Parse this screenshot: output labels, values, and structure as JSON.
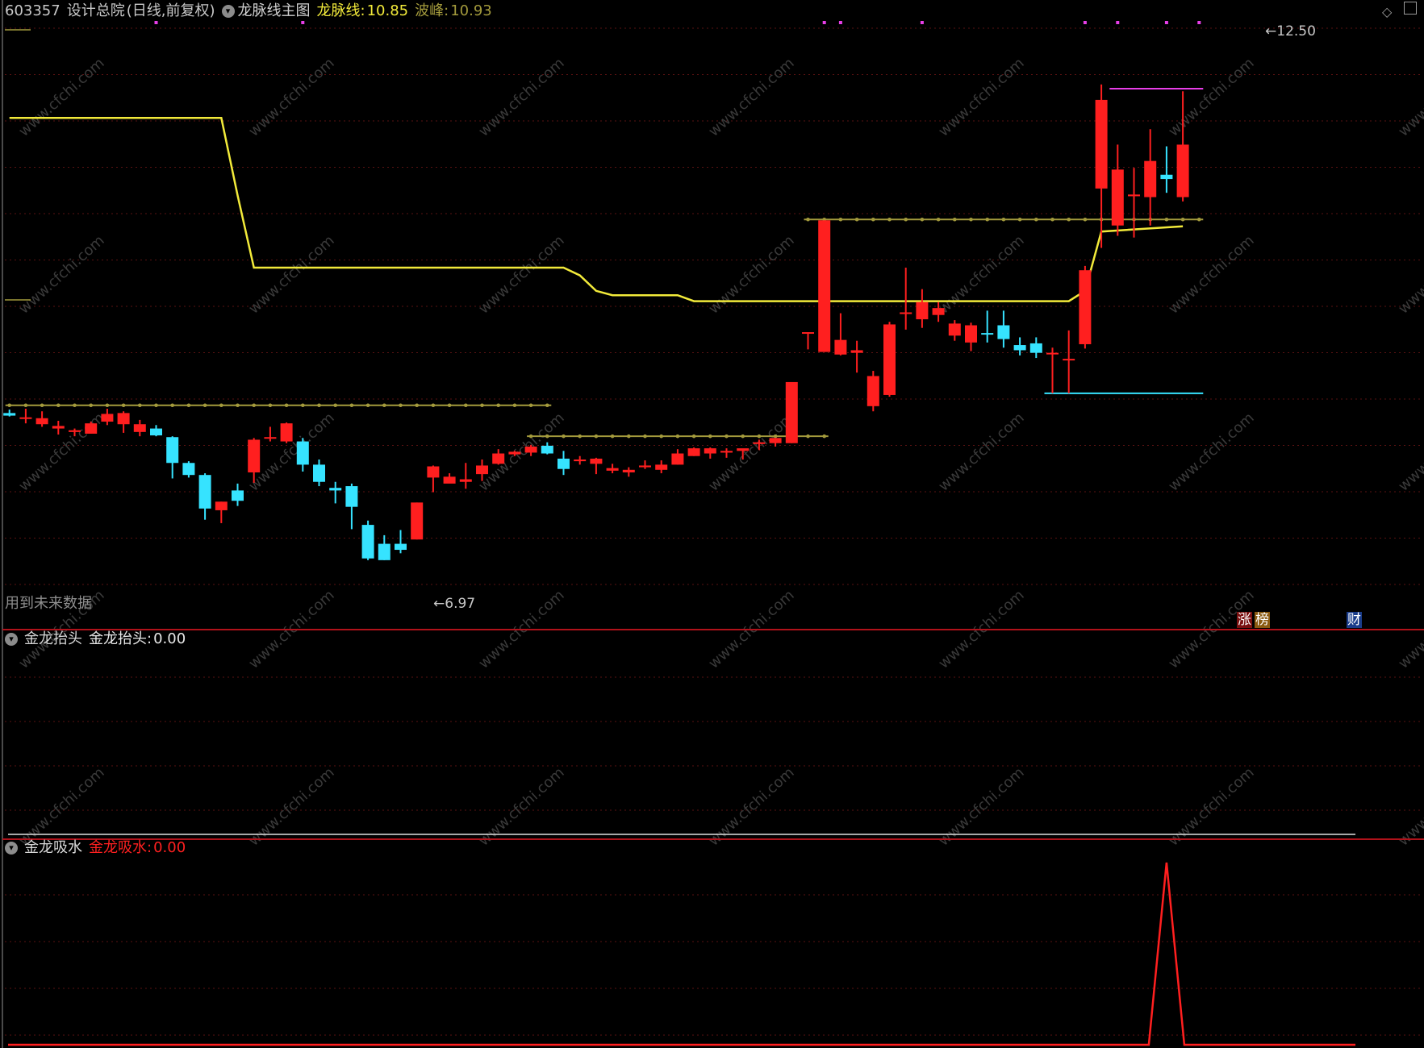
{
  "header": {
    "code": "603357",
    "name": "设计总院",
    "period": "(日线,前复权)",
    "indicator_name": "龙脉线主图",
    "line_label": "龙脉线:",
    "line_value": "10.85",
    "peak_label": "波峰:",
    "peak_value": "10.93"
  },
  "panel2": {
    "title": "金龙抬头",
    "label": "金龙抬头:",
    "value": "0.00"
  },
  "panel3": {
    "title": "金龙吸水",
    "label": "金龙吸水:",
    "value": "0.00"
  },
  "annotations": {
    "high_marker": "12.50",
    "low_marker": "6.97",
    "future_data_note": "用到未来数据"
  },
  "badges": {
    "zhang": "涨",
    "bang": "榜",
    "cai": "财"
  },
  "watermark": "www.cfchi.com",
  "colors": {
    "background": "#000000",
    "up": "#ff1f1f",
    "down": "#36e3ff",
    "line_yellow": "#f2ea3a",
    "line_olive": "#a39a3c",
    "magenta": "#e83ee8",
    "panel_divider": "#b0121a",
    "grid": "#5a1212"
  },
  "chart_data": {
    "type": "candlestick",
    "price_range": [
      6.5,
      13.2
    ],
    "candles": [
      {
        "o": 8.68,
        "h": 8.72,
        "l": 8.64,
        "c": 8.65
      },
      {
        "o": 8.62,
        "h": 8.73,
        "l": 8.56,
        "c": 8.63
      },
      {
        "o": 8.55,
        "h": 8.7,
        "l": 8.52,
        "c": 8.62
      },
      {
        "o": 8.5,
        "h": 8.59,
        "l": 8.43,
        "c": 8.53
      },
      {
        "o": 8.46,
        "h": 8.5,
        "l": 8.41,
        "c": 8.48
      },
      {
        "o": 8.44,
        "h": 8.58,
        "l": 8.44,
        "c": 8.56
      },
      {
        "o": 8.58,
        "h": 8.73,
        "l": 8.54,
        "c": 8.67
      },
      {
        "o": 8.55,
        "h": 8.7,
        "l": 8.45,
        "c": 8.68
      },
      {
        "o": 8.46,
        "h": 8.6,
        "l": 8.41,
        "c": 8.55
      },
      {
        "o": 8.5,
        "h": 8.54,
        "l": 8.41,
        "c": 8.42
      },
      {
        "o": 8.4,
        "h": 8.41,
        "l": 7.92,
        "c": 8.1
      },
      {
        "o": 8.1,
        "h": 8.12,
        "l": 7.93,
        "c": 7.96
      },
      {
        "o": 7.96,
        "h": 7.98,
        "l": 7.44,
        "c": 7.57
      },
      {
        "o": 7.55,
        "h": 7.65,
        "l": 7.4,
        "c": 7.65
      },
      {
        "o": 7.78,
        "h": 7.86,
        "l": 7.6,
        "c": 7.66
      },
      {
        "o": 7.99,
        "h": 8.39,
        "l": 7.87,
        "c": 8.37
      },
      {
        "o": 8.4,
        "h": 8.52,
        "l": 8.35,
        "c": 8.4
      },
      {
        "o": 8.35,
        "h": 8.57,
        "l": 8.33,
        "c": 8.56
      },
      {
        "o": 8.35,
        "h": 8.39,
        "l": 8.0,
        "c": 8.08
      },
      {
        "o": 8.08,
        "h": 8.14,
        "l": 7.83,
        "c": 7.88
      },
      {
        "o": 7.81,
        "h": 7.88,
        "l": 7.63,
        "c": 7.78
      },
      {
        "o": 7.83,
        "h": 7.86,
        "l": 7.33,
        "c": 7.59
      },
      {
        "o": 7.38,
        "h": 7.43,
        "l": 6.97,
        "c": 6.99
      },
      {
        "o": 7.16,
        "h": 7.26,
        "l": 6.97,
        "c": 6.97
      },
      {
        "o": 7.16,
        "h": 7.32,
        "l": 7.05,
        "c": 7.09
      },
      {
        "o": 7.21,
        "h": 7.64,
        "l": 7.21,
        "c": 7.64
      },
      {
        "o": 7.93,
        "h": 8.07,
        "l": 7.76,
        "c": 8.06
      },
      {
        "o": 7.86,
        "h": 7.98,
        "l": 7.89,
        "c": 7.94
      },
      {
        "o": 7.88,
        "h": 8.1,
        "l": 7.8,
        "c": 7.91
      },
      {
        "o": 7.97,
        "h": 8.14,
        "l": 7.89,
        "c": 8.07
      },
      {
        "o": 8.09,
        "h": 8.26,
        "l": 8.08,
        "c": 8.21
      },
      {
        "o": 8.2,
        "h": 8.24,
        "l": 8.18,
        "c": 8.23
      },
      {
        "o": 8.22,
        "h": 8.31,
        "l": 8.18,
        "c": 8.29
      },
      {
        "o": 8.3,
        "h": 8.34,
        "l": 8.2,
        "c": 8.21
      },
      {
        "o": 8.15,
        "h": 8.24,
        "l": 7.96,
        "c": 8.03
      },
      {
        "o": 8.12,
        "h": 8.18,
        "l": 8.08,
        "c": 8.14
      },
      {
        "o": 8.09,
        "h": 8.16,
        "l": 7.97,
        "c": 8.15
      },
      {
        "o": 8.01,
        "h": 8.09,
        "l": 7.98,
        "c": 8.04
      },
      {
        "o": 7.99,
        "h": 8.05,
        "l": 7.94,
        "c": 8.02
      },
      {
        "o": 8.05,
        "h": 8.13,
        "l": 8.03,
        "c": 8.07
      },
      {
        "o": 8.02,
        "h": 8.13,
        "l": 7.98,
        "c": 8.08
      },
      {
        "o": 8.08,
        "h": 8.26,
        "l": 8.08,
        "c": 8.21
      },
      {
        "o": 8.18,
        "h": 8.28,
        "l": 8.18,
        "c": 8.27
      },
      {
        "o": 8.21,
        "h": 8.28,
        "l": 8.15,
        "c": 8.27
      },
      {
        "o": 8.22,
        "h": 8.27,
        "l": 8.16,
        "c": 8.24
      },
      {
        "o": 8.24,
        "h": 8.26,
        "l": 8.14,
        "c": 8.27
      },
      {
        "o": 8.32,
        "h": 8.37,
        "l": 8.25,
        "c": 8.34
      },
      {
        "o": 8.33,
        "h": 8.39,
        "l": 8.29,
        "c": 8.39
      },
      {
        "o": 8.33,
        "h": 9.04,
        "l": 8.33,
        "c": 9.04
      },
      {
        "o": 9.62,
        "h": 9.62,
        "l": 9.42,
        "c": 9.62
      },
      {
        "o": 9.39,
        "h": 10.92,
        "l": 9.39,
        "c": 10.92
      },
      {
        "o": 9.36,
        "h": 9.84,
        "l": 9.35,
        "c": 9.53
      },
      {
        "o": 9.38,
        "h": 9.52,
        "l": 9.15,
        "c": 9.41
      },
      {
        "o": 8.76,
        "h": 9.17,
        "l": 8.7,
        "c": 9.11
      },
      {
        "o": 8.89,
        "h": 9.74,
        "l": 8.87,
        "c": 9.71
      },
      {
        "o": 9.85,
        "h": 10.37,
        "l": 9.65,
        "c": 9.85
      },
      {
        "o": 9.77,
        "h": 10.12,
        "l": 9.67,
        "c": 9.97
      },
      {
        "o": 9.82,
        "h": 9.97,
        "l": 9.74,
        "c": 9.9
      },
      {
        "o": 9.58,
        "h": 9.76,
        "l": 9.52,
        "c": 9.72
      },
      {
        "o": 9.5,
        "h": 9.73,
        "l": 9.4,
        "c": 9.7
      },
      {
        "o": 9.61,
        "h": 9.87,
        "l": 9.5,
        "c": 9.6
      },
      {
        "o": 9.7,
        "h": 9.87,
        "l": 9.44,
        "c": 9.54
      },
      {
        "o": 9.47,
        "h": 9.56,
        "l": 9.35,
        "c": 9.41
      },
      {
        "o": 9.49,
        "h": 9.56,
        "l": 9.32,
        "c": 9.38
      },
      {
        "o": 9.38,
        "h": 9.44,
        "l": 8.91,
        "c": 9.38
      },
      {
        "o": 9.31,
        "h": 9.64,
        "l": 8.91,
        "c": 9.31
      },
      {
        "o": 9.48,
        "h": 10.39,
        "l": 9.43,
        "c": 10.34
      },
      {
        "o": 11.29,
        "h": 12.5,
        "l": 10.6,
        "c": 12.32
      },
      {
        "o": 10.86,
        "h": 11.8,
        "l": 10.74,
        "c": 11.51
      },
      {
        "o": 11.2,
        "h": 11.53,
        "l": 10.72,
        "c": 11.22
      },
      {
        "o": 11.19,
        "h": 11.98,
        "l": 10.86,
        "c": 11.61
      },
      {
        "o": 11.45,
        "h": 11.78,
        "l": 11.24,
        "c": 11.4
      },
      {
        "o": 11.19,
        "h": 12.42,
        "l": 11.14,
        "c": 11.8
      }
    ],
    "longmai_line": [
      {
        "i": 0,
        "v": 12.11
      },
      {
        "i": 13,
        "v": 12.11
      },
      {
        "i": 14,
        "v": 11.21
      },
      {
        "i": 15,
        "v": 10.37
      },
      {
        "i": 34,
        "v": 10.37
      },
      {
        "i": 35,
        "v": 10.28
      },
      {
        "i": 36,
        "v": 10.1
      },
      {
        "i": 37,
        "v": 10.05
      },
      {
        "i": 41,
        "v": 10.05
      },
      {
        "i": 42,
        "v": 9.98
      },
      {
        "i": 65,
        "v": 9.98
      },
      {
        "i": 66,
        "v": 10.1
      },
      {
        "i": 67,
        "v": 10.79
      },
      {
        "i": 72,
        "v": 10.85
      }
    ],
    "peak_levels": [
      {
        "from": 0,
        "to": 33,
        "v": 8.77
      },
      {
        "from": 32,
        "to": 50,
        "v": 8.41
      },
      {
        "from": 49,
        "to": 73,
        "v": 10.93
      }
    ],
    "support_level": {
      "from": 64,
      "to": 73,
      "v": 8.91
    },
    "jinlong_taitou": {
      "value": 0.0
    },
    "jinlong_xishui": {
      "spike_index": 71,
      "baseline": 0.0
    }
  }
}
